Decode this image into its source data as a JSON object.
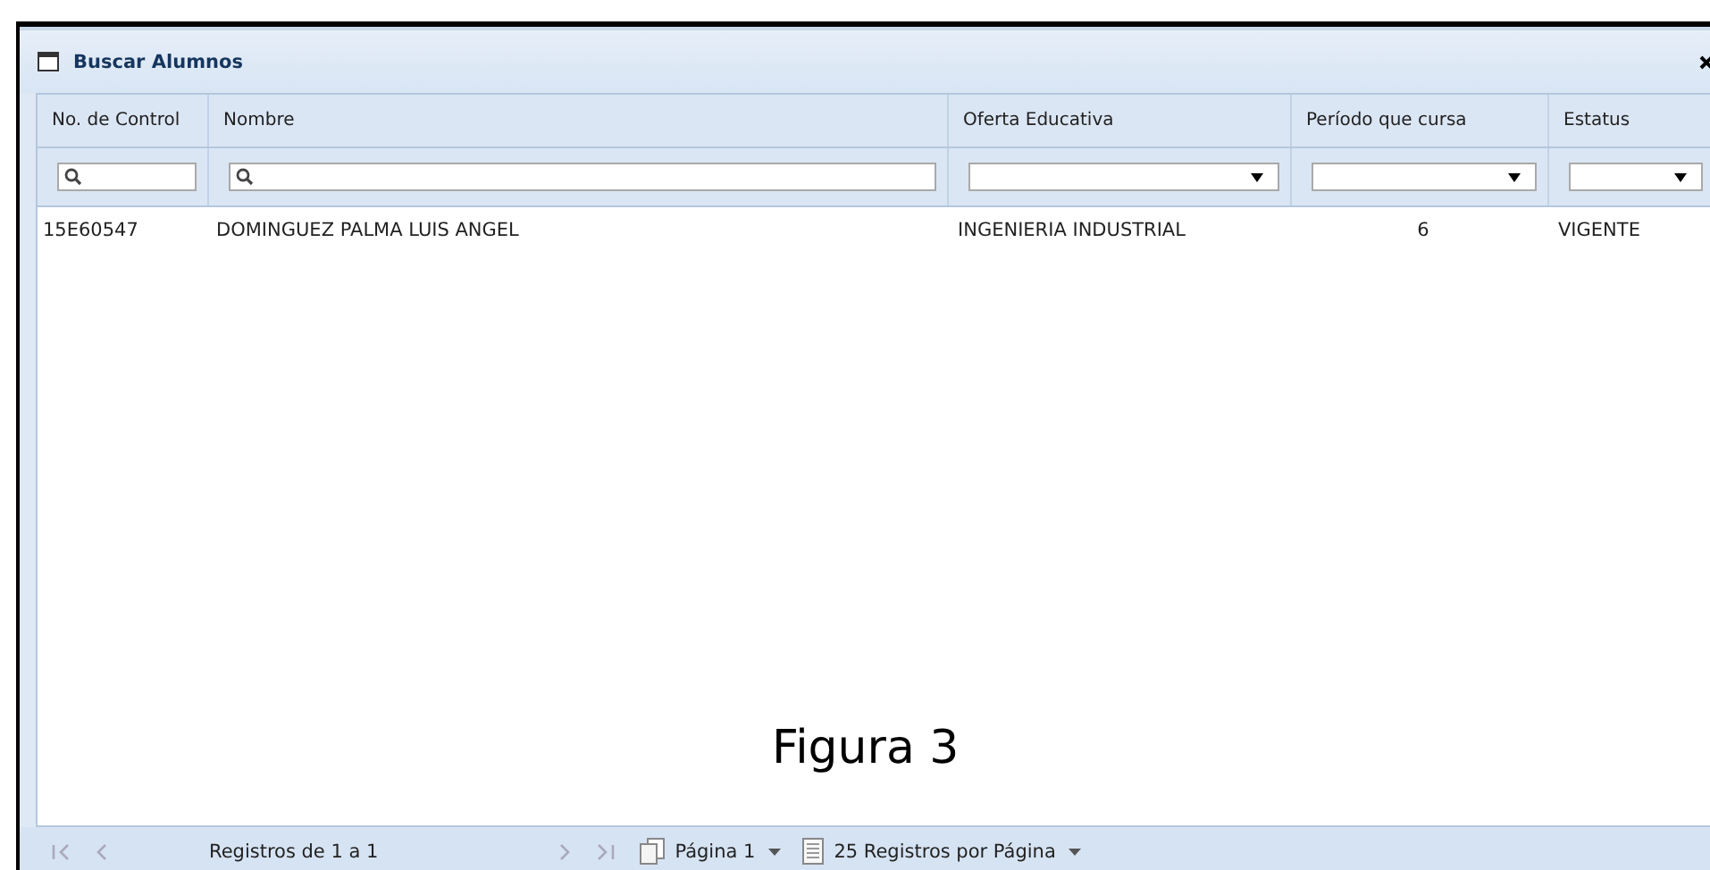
{
  "window": {
    "title": "Buscar Alumnos"
  },
  "table": {
    "columns": [
      {
        "label": "No. de Control",
        "kind": "text"
      },
      {
        "label": "Nombre",
        "kind": "text"
      },
      {
        "label": "Oferta Educativa",
        "kind": "select"
      },
      {
        "label": "Período que cursa",
        "kind": "select"
      },
      {
        "label": "Estatus",
        "kind": "select"
      }
    ],
    "rows": [
      {
        "cells": [
          "15E60547",
          "DOMINGUEZ PALMA LUIS ANGEL",
          "INGENIERIA INDUSTRIAL",
          "6",
          "VIGENTE"
        ]
      }
    ]
  },
  "caption": "Figura 3",
  "pager": {
    "first_disabled": true,
    "prev_disabled": true,
    "records": "Registros de 1 a 1",
    "next_disabled": true,
    "last_disabled": true,
    "page": "Página 1",
    "page_size": "25 Registros por Página"
  }
}
